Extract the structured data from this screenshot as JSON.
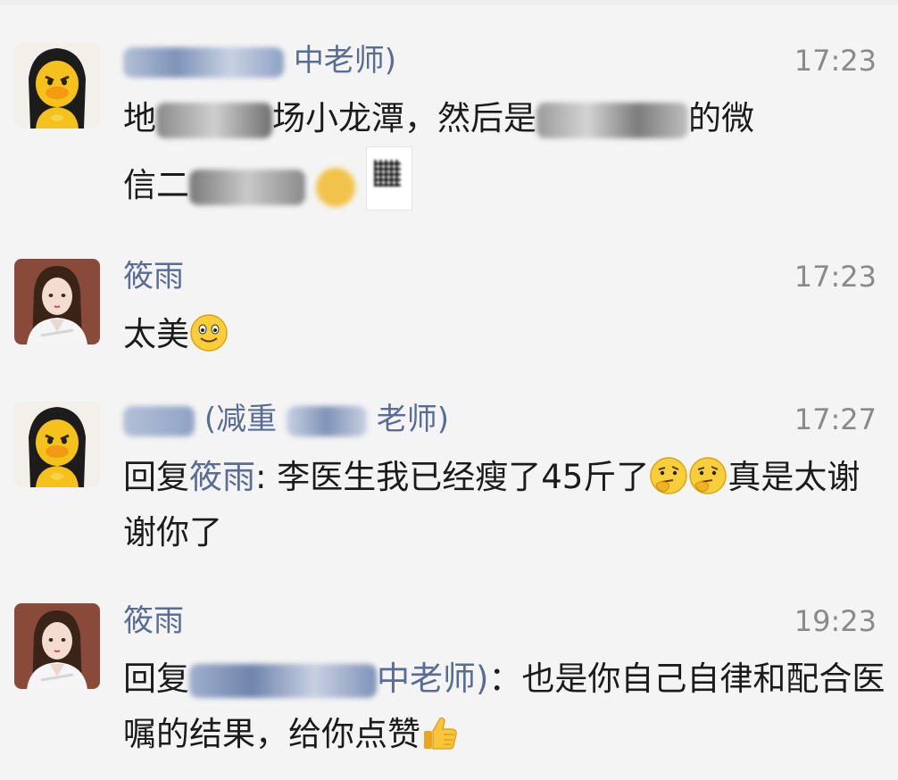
{
  "comments": [
    {
      "name_visible": "中老师)",
      "time": "17:23",
      "line1_start": "地",
      "line1_mid": "场小龙潭，然后是",
      "line1_end": "的微",
      "line2_start": "信二"
    },
    {
      "name": "筱雨",
      "time": "17:23",
      "text": "太美",
      "emoji": "smile-emoji"
    },
    {
      "name_visible_a": "(减重",
      "name_visible_b": "老师)",
      "time": "17:27",
      "reply_prefix": "回复",
      "reply_target": "筱雨",
      "reply_colon": ": ",
      "text_a": "李医生我已经瘦了45斤了",
      "text_b": "真是太谢谢你了",
      "emoji": "thinking-emoji"
    },
    {
      "name": "筱雨",
      "time": "19:23",
      "reply_prefix": "回复",
      "reply_target_visible": "中老师)",
      "reply_colon": "：",
      "text": "也是你自己自律和配合医嘱的结果，给你点赞",
      "emoji": "thumbs-up-emoji"
    }
  ],
  "colors": {
    "background": "#f4f4f4",
    "name_link": "#586c94",
    "time": "#8a8a8a",
    "text": "#1b1b1b"
  }
}
